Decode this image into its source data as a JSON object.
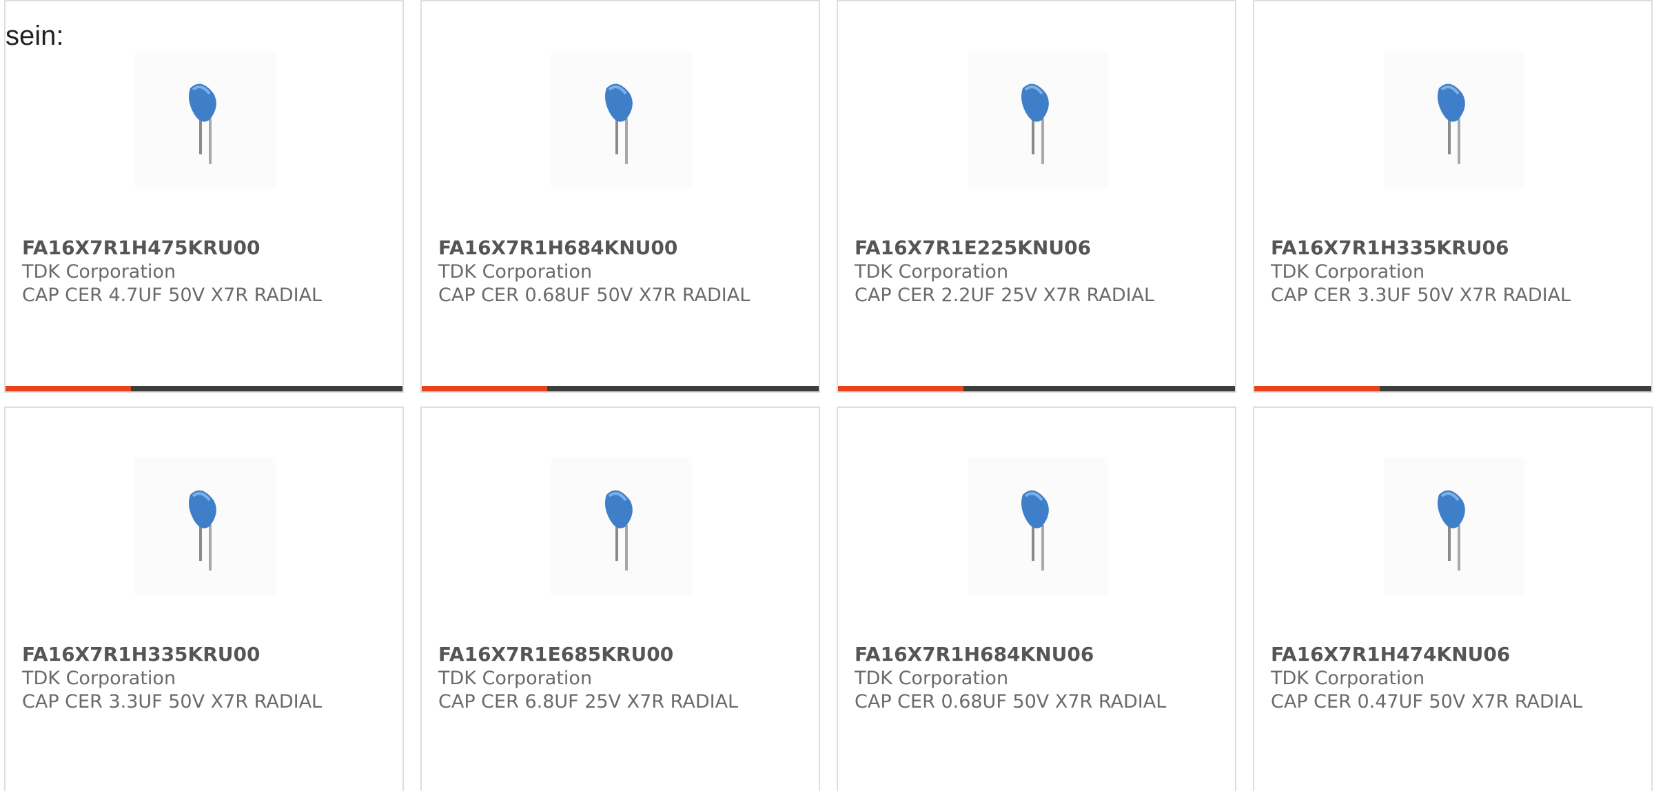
{
  "intro_text": "sein:",
  "accent_color": "#e8431a",
  "products": [
    {
      "part_number": "FA16X7R1H475KRU00",
      "manufacturer": "TDK Corporation",
      "description": "CAP CER 4.7UF 50V X7R RADIAL",
      "image_icon": "radial-capacitor-icon"
    },
    {
      "part_number": "FA16X7R1H684KNU00",
      "manufacturer": "TDK Corporation",
      "description": "CAP CER 0.68UF 50V X7R RADIAL",
      "image_icon": "radial-capacitor-icon"
    },
    {
      "part_number": "FA16X7R1E225KNU06",
      "manufacturer": "TDK Corporation",
      "description": "CAP CER 2.2UF 25V X7R RADIAL",
      "image_icon": "radial-capacitor-icon"
    },
    {
      "part_number": "FA16X7R1H335KRU06",
      "manufacturer": "TDK Corporation",
      "description": "CAP CER 3.3UF 50V X7R RADIAL",
      "image_icon": "radial-capacitor-icon"
    },
    {
      "part_number": "FA16X7R1H335KRU00",
      "manufacturer": "TDK Corporation",
      "description": "CAP CER 3.3UF 50V X7R RADIAL",
      "image_icon": "radial-capacitor-icon"
    },
    {
      "part_number": "FA16X7R1E685KRU00",
      "manufacturer": "TDK Corporation",
      "description": "CAP CER 6.8UF 25V X7R RADIAL",
      "image_icon": "radial-capacitor-icon"
    },
    {
      "part_number": "FA16X7R1H684KNU06",
      "manufacturer": "TDK Corporation",
      "description": "CAP CER 0.68UF 50V X7R RADIAL",
      "image_icon": "radial-capacitor-icon"
    },
    {
      "part_number": "FA16X7R1H474KNU06",
      "manufacturer": "TDK Corporation",
      "description": "CAP CER 0.47UF 50V X7R RADIAL",
      "image_icon": "radial-capacitor-icon"
    }
  ]
}
